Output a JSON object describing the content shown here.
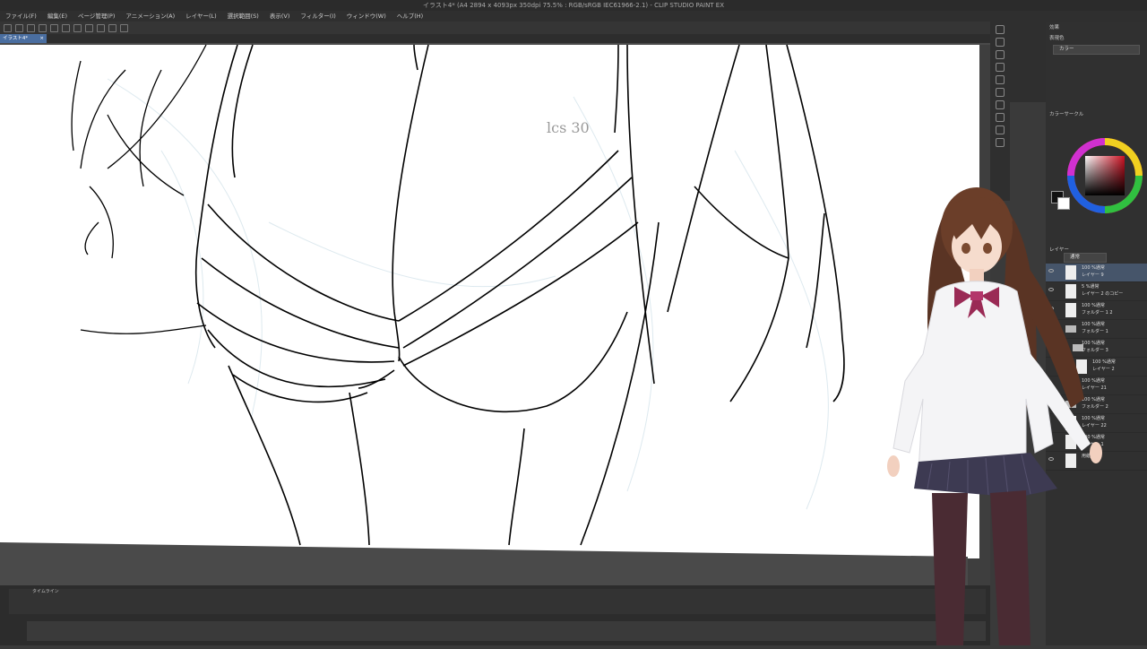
{
  "window": {
    "title": "イラスト4* (A4 2894 x 4093px 350dpi 75.5% : RGB/sRGB IEC61966-2.1) - CLIP STUDIO PAINT EX"
  },
  "menu": [
    "ファイル(F)",
    "編集(E)",
    "ページ管理(P)",
    "アニメーション(A)",
    "レイヤー(L)",
    "選択範囲(S)",
    "表示(V)",
    "フィルター(I)",
    "ウィンドウ(W)",
    "ヘルプ(H)"
  ],
  "tab": {
    "label": "イラスト4*",
    "close": "×"
  },
  "canvas": {
    "annotation": "lcs 30"
  },
  "timeline": {
    "label": "タイムライン"
  },
  "right_panel": {
    "effect_label": "効果",
    "display_color_label": "表現色",
    "display_color_value": "カラー",
    "color_circle_label": "カラーサークル",
    "layer_label": "レイヤー",
    "blend_mode": "通常",
    "layers": [
      {
        "opacity": "100 %通常",
        "name": "レイヤー 9",
        "selected": true
      },
      {
        "opacity": "5 %通常",
        "name": "レイヤー 2 のコピー",
        "selected": false
      },
      {
        "opacity": "100 %通常",
        "name": "フォルダー 1 2",
        "selected": false
      },
      {
        "opacity": "100 %通常",
        "name": "フォルダー 1",
        "selected": false
      },
      {
        "opacity": "100 %通常",
        "name": "フォルダー 3",
        "selected": false
      },
      {
        "opacity": "100 %通常",
        "name": "レイヤー 2",
        "selected": false
      },
      {
        "opacity": "100 %通常",
        "name": "レイヤー 21",
        "selected": false
      },
      {
        "opacity": "100 %通常",
        "name": "フォルダー 2",
        "selected": false
      },
      {
        "opacity": "100 %通常",
        "name": "レイヤー 22",
        "selected": false
      },
      {
        "opacity": "100 %通常",
        "name": "レイヤー 1",
        "selected": false
      },
      {
        "opacity": "",
        "name": "用紙",
        "selected": false
      }
    ]
  },
  "colors": {
    "accent": "#4a6ea0",
    "panel_bg": "#303030",
    "canvas_bg": "#4a4a4a",
    "main_color": "#111111",
    "sub_color": "#ffffff"
  }
}
